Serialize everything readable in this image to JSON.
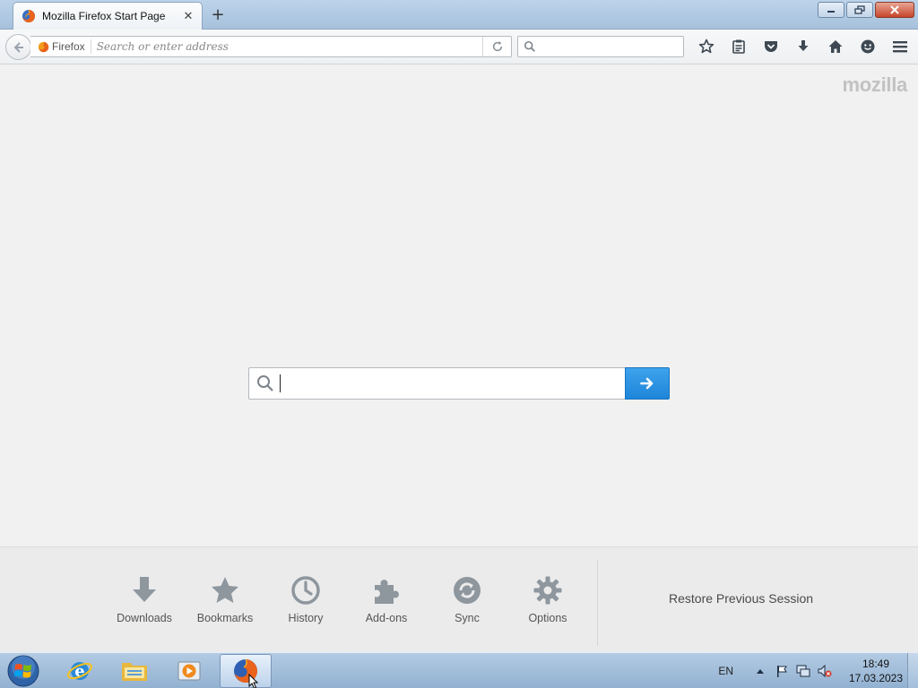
{
  "window": {
    "tab_title": "Mozilla Firefox Start Page",
    "tab_close": "✕",
    "new_tab": "+",
    "controls": [
      "minimize",
      "maximize",
      "close"
    ]
  },
  "navbar": {
    "identity_label": "Firefox",
    "url_placeholder": "Search or enter address",
    "search_placeholder": "",
    "toolbar_icons": [
      "bookmark-star-icon",
      "reading-list-icon",
      "pocket-icon",
      "downloads-icon",
      "home-icon",
      "hello-icon"
    ]
  },
  "content": {
    "brand_logo": "mozilla",
    "search_value": "",
    "accent_color": "#2f94e3"
  },
  "launcher": {
    "items": [
      {
        "label": "Downloads",
        "icon": "downloads-icon"
      },
      {
        "label": "Bookmarks",
        "icon": "bookmarks-icon"
      },
      {
        "label": "History",
        "icon": "history-icon"
      },
      {
        "label": "Add-ons",
        "icon": "addons-icon"
      },
      {
        "label": "Sync",
        "icon": "sync-icon"
      },
      {
        "label": "Options",
        "icon": "options-icon"
      }
    ],
    "restore_session": "Restore Previous Session"
  },
  "taskbar": {
    "pinned": [
      "internet-explorer-icon",
      "file-explorer-icon",
      "media-player-icon",
      "firefox-icon"
    ],
    "active": "firefox-icon",
    "language": "EN",
    "time": "18:49",
    "date": "17.03.2023"
  }
}
